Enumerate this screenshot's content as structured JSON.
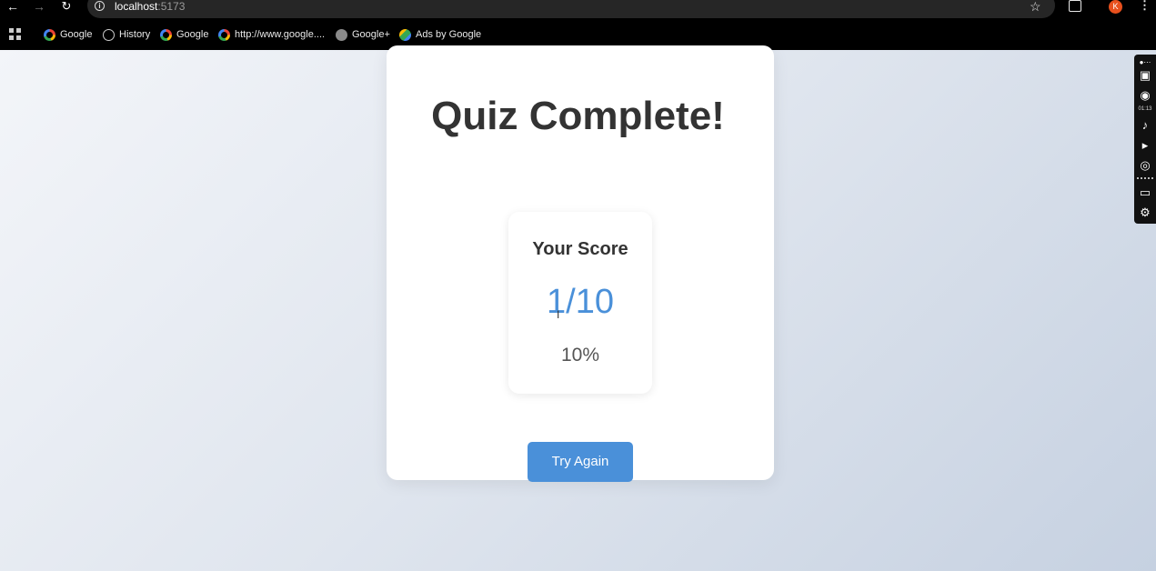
{
  "browser": {
    "url_host": "localhost",
    "url_port": ":5173",
    "avatar_letter": "K",
    "bookmarks": [
      {
        "label": "Google",
        "icon": "google-icon"
      },
      {
        "label": "History",
        "icon": "history-icon"
      },
      {
        "label": "Google",
        "icon": "google-icon"
      },
      {
        "label": "http://www.google....",
        "icon": "google-icon"
      },
      {
        "label": "Google+",
        "icon": "globe-icon"
      },
      {
        "label": "Ads by Google",
        "icon": "ads-icon"
      }
    ]
  },
  "quiz": {
    "title": "Quiz Complete!",
    "score_label": "Your Score",
    "score_value": "1/10",
    "score_percent": "10%",
    "try_again_label": "Try Again"
  },
  "recorder": {
    "timer": "01:13"
  },
  "colors": {
    "accent": "#4a90d9",
    "heading": "#333333"
  }
}
